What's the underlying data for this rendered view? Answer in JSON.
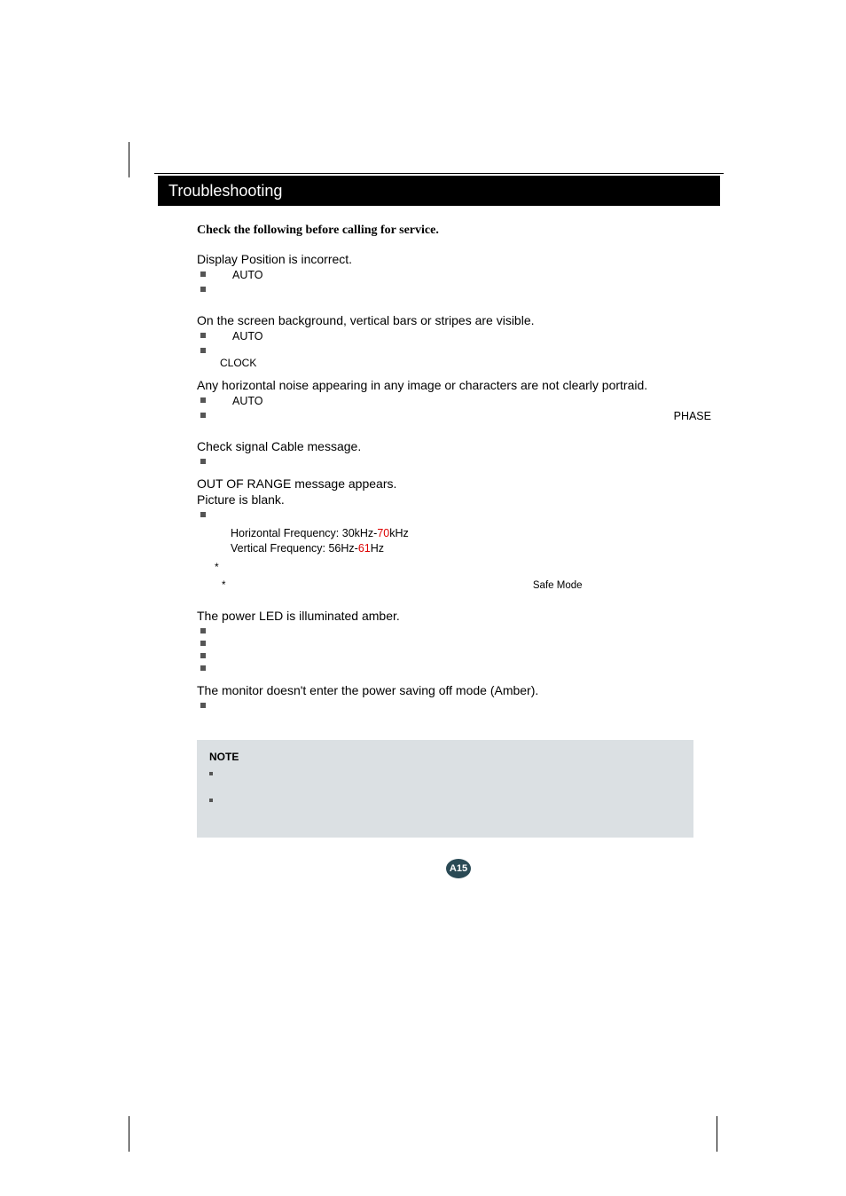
{
  "titlebar": "Troubleshooting",
  "lead": "Check the following before calling for service.",
  "sections": {
    "s1": {
      "heading": "Display Position is incorrect.",
      "b0": "AUTO",
      "b1": ""
    },
    "s2": {
      "heading": "On the screen background, vertical bars or stripes are visible.",
      "b0": "AUTO",
      "b1": "",
      "sub": "CLOCK"
    },
    "s3": {
      "heading": "Any horizontal noise appearing in any image or characters are not clearly portraid.",
      "b0": "AUTO",
      "b1_text": "PHASE"
    },
    "s4": {
      "heading": "Check signal Cable message.",
      "b0": ""
    },
    "s5": {
      "heading_a": "OUT OF RANGE message appears.",
      "heading_b": "Picture is blank.",
      "b0": "",
      "sub1_pre": "Horizontal Frequency: 30kHz-",
      "sub1_red": "70",
      "sub1_post": "kHz",
      "sub2_pre": "Vertical Frequency: 56Hz-",
      "sub2_red": "61",
      "sub2_post": "Hz",
      "star1": "*",
      "star2_pre": "*",
      "star2_text": "Safe Mode"
    },
    "s6": {
      "heading": "The power LED is illuminated amber.",
      "b0": "",
      "b1": "",
      "b2": "",
      "b3": ""
    },
    "s7": {
      "heading": "The monitor doesn't enter the power saving off mode (Amber).",
      "b0": ""
    }
  },
  "note": {
    "title": "NOTE",
    "n0": "",
    "n1": ""
  },
  "page_number": "A15"
}
